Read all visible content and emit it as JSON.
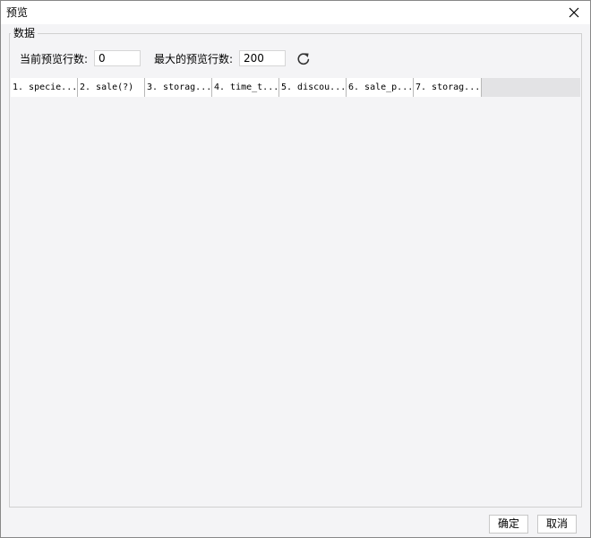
{
  "window": {
    "title": "预览"
  },
  "group": {
    "legend": "数据"
  },
  "controls": {
    "current_rows_label": "当前预览行数:",
    "current_rows_value": "0",
    "max_rows_label": "最大的预览行数:",
    "max_rows_value": "200"
  },
  "table": {
    "columns": [
      "1. specie...",
      "2. sale(?)",
      "3. storag...",
      "4. time_t...",
      "5. discou...",
      "6. sale_p...",
      "7. storag..."
    ]
  },
  "footer": {
    "ok_label": "确定",
    "cancel_label": "取消"
  },
  "icons": {
    "close": "close-icon",
    "refresh": "refresh-icon"
  }
}
